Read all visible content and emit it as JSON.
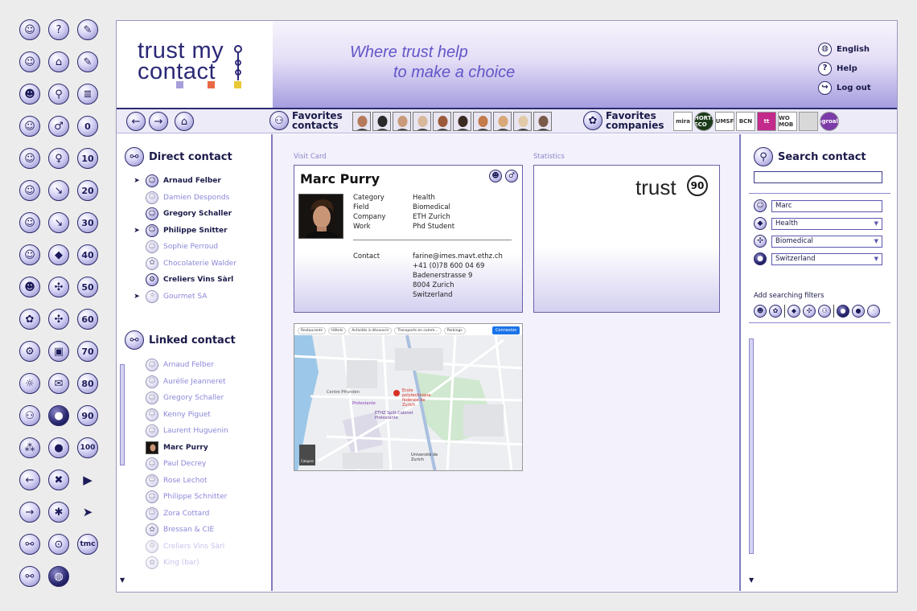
{
  "header": {
    "logo_text": [
      "trust my",
      "contact"
    ],
    "tagline": [
      "Where trust help",
      "to make a choice"
    ],
    "nav": [
      {
        "label": "English",
        "icon": "globe-icon"
      },
      {
        "label": "Help",
        "icon": "help-icon"
      },
      {
        "label": "Log out",
        "icon": "logout-icon"
      }
    ]
  },
  "favbar": {
    "contacts_label": [
      "Favorites",
      "contacts"
    ],
    "companies_label": [
      "Favorites",
      "companies"
    ],
    "company_logos": [
      "mira",
      "HORTI ECO",
      "UMSF",
      "BCN",
      "tt",
      "WO MOB",
      "",
      "agroalt"
    ]
  },
  "left": {
    "direct_title": "Direct contact",
    "direct": [
      {
        "label": "Arnaud Felber",
        "style": "bold",
        "arrow": true
      },
      {
        "label": "Damien Desponds",
        "style": "faint",
        "arrow": false
      },
      {
        "label": "Gregory Schaller",
        "style": "bold",
        "arrow": false
      },
      {
        "label": "Philippe Snitter",
        "style": "bold",
        "arrow": true
      },
      {
        "label": "Sophie Perroud",
        "style": "faint",
        "arrow": false
      },
      {
        "label": "Chocolaterie Walder",
        "style": "faint",
        "arrow": false
      },
      {
        "label": "Creliers Vins Sàrl",
        "style": "bold",
        "arrow": false
      },
      {
        "label": "Gourmet SA",
        "style": "faint",
        "arrow": true
      }
    ],
    "linked_title": "Linked contact",
    "linked": [
      {
        "label": "Arnaud Felber",
        "style": "faint"
      },
      {
        "label": "Aurélie Jeanneret",
        "style": "faint"
      },
      {
        "label": "Gregory Schaller",
        "style": "faint"
      },
      {
        "label": "Kenny Piguet",
        "style": "faint"
      },
      {
        "label": "Laurent Huguenin",
        "style": "faint"
      },
      {
        "label": "Marc Purry",
        "style": "bold"
      },
      {
        "label": "Paul Decrey",
        "style": "faint"
      },
      {
        "label": "Rose Lechot",
        "style": "faint"
      },
      {
        "label": "Philippe Schnitter",
        "style": "faint"
      },
      {
        "label": "Zora Cottard",
        "style": "faint"
      },
      {
        "label": "Bressan & CIE",
        "style": "faint"
      },
      {
        "label": "Creliers Vins Sàrl",
        "style": "vfaint"
      },
      {
        "label": "King (bar)",
        "style": "vfaint"
      }
    ]
  },
  "main": {
    "visit_card_label": "Visit Card",
    "statistics_label": "Statistics",
    "card": {
      "name": "Marc Purry",
      "fields": [
        {
          "k": "Category",
          "v": "Health"
        },
        {
          "k": "Field",
          "v": "Biomedical"
        },
        {
          "k": "Company",
          "v": "ETH Zurich"
        },
        {
          "k": "Work",
          "v": "Phd Student"
        }
      ],
      "contact_label": "Contact",
      "contact_lines": [
        "farine@imes.mavt.ethz.ch",
        "+41 (0)78 600 04 69",
        "Badenerstrasse 9",
        "8004 Zurich",
        "Switzerland"
      ]
    },
    "stats": {
      "trust_word": "trust",
      "score": "90"
    },
    "map": {
      "chips": [
        "Restaurants",
        "Hôtels",
        "Activités à découvrir",
        "Transports en comm...",
        "Parkings"
      ],
      "connect": "Connexion",
      "labels": [
        "Centre Pfrunden",
        "Protestante",
        "ETHZ Spitt Cabinet Protestante",
        "Université de Zurich",
        "Ecole polytechnique fédérale de Zurich"
      ],
      "layers": "Calques"
    }
  },
  "right": {
    "title": "Search contact",
    "search_value": "",
    "filters": [
      {
        "value": "Marc",
        "dropdown": false
      },
      {
        "value": "Health",
        "dropdown": true
      },
      {
        "value": "Biomedical",
        "dropdown": true
      },
      {
        "value": "Switzerland",
        "dropdown": true
      }
    ],
    "add_filters_label": "Add searching filters"
  },
  "sidebar_icons": {
    "numbers": [
      "0",
      "10",
      "20",
      "30",
      "40",
      "50",
      "60",
      "70",
      "80",
      "90",
      "100"
    ],
    "tmc": "tmc"
  }
}
